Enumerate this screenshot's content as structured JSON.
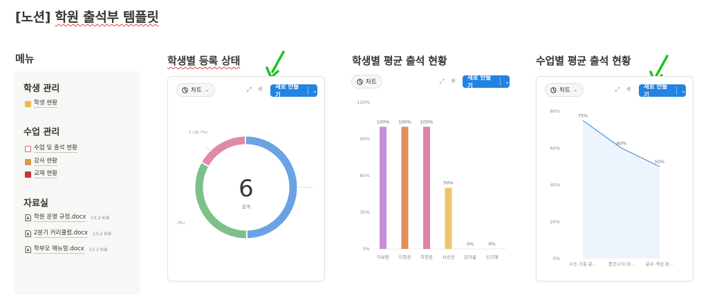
{
  "page": {
    "title_prefix": "[노션]",
    "title_rest": "학원 출석부 템플릿"
  },
  "menu": {
    "heading": "메뉴",
    "sections": [
      {
        "title": "학생 관리",
        "items": [
          {
            "label": "학생 현황",
            "icon": "students-icon"
          }
        ]
      },
      {
        "title": "수업 관리",
        "items": [
          {
            "label": "수업 및 출석 현황",
            "icon": "calendar-icon"
          },
          {
            "label": "강사 현황",
            "icon": "teacher-icon"
          },
          {
            "label": "교재 현황",
            "icon": "book-icon"
          }
        ]
      },
      {
        "title": "자료실",
        "items": [
          {
            "label": "학원 운영 규정.docx",
            "size": "13.2 KiB",
            "icon": "file-icon"
          },
          {
            "label": "2분기 커리큘럼.docx",
            "size": "13.2 KiB",
            "icon": "file-icon"
          },
          {
            "label": "학부모 매뉴얼.docx",
            "size": "13.2 KiB",
            "icon": "file-icon"
          }
        ]
      }
    ]
  },
  "cards": {
    "chip_label": "차트",
    "new_button": "새로 만들기",
    "titles": [
      "학생별 등록 상태",
      "학생별 평균 출석 현황",
      "수업별 평균 출석 현황"
    ]
  },
  "colors": {
    "accent": "#2383e2",
    "arrow": "#19c319"
  },
  "chart_data": [
    {
      "type": "pie",
      "title": "학생별 등록 상태",
      "center_value": "6",
      "center_label": "합계",
      "slices": [
        {
          "value": 3,
          "color": "#6aa3e3",
          "label": ""
        },
        {
          "value": 2,
          "color": "#7cc08a",
          "label": ".3%)"
        },
        {
          "value": 1,
          "color": "#e08aab",
          "label": "1 (16.7%)"
        }
      ]
    },
    {
      "type": "bar",
      "title": "학생별 평균 출석 현황",
      "categories": [
        "이보람",
        "이형권",
        "최종훈",
        "서승연",
        "김아름",
        "신지혜"
      ],
      "values": [
        100,
        100,
        100,
        50,
        0,
        0
      ],
      "value_labels": [
        "100%",
        "100%",
        "100%",
        "50%",
        "0%",
        "0%"
      ],
      "colors": [
        "#c98fd6",
        "#de8f57",
        "#df82aa",
        "#eec56e",
        "#cccccc",
        "#cccccc"
      ],
      "ylim": [
        0,
        120
      ],
      "yticks": [
        "0%",
        "30%",
        "60%",
        "90%",
        "120%"
      ]
    },
    {
      "type": "area",
      "title": "수업별 평균 출석 현황",
      "categories": [
        "수능 기출 분...",
        "중간고사 대...",
        "분수 개념 완..."
      ],
      "values": [
        75,
        60,
        50
      ],
      "value_labels": [
        "75%",
        "60%",
        "50%"
      ],
      "ylim": [
        0,
        80
      ],
      "yticks": [
        "0%",
        "20%",
        "40%",
        "60%",
        "80%"
      ],
      "color": "#4a8fd6"
    }
  ]
}
